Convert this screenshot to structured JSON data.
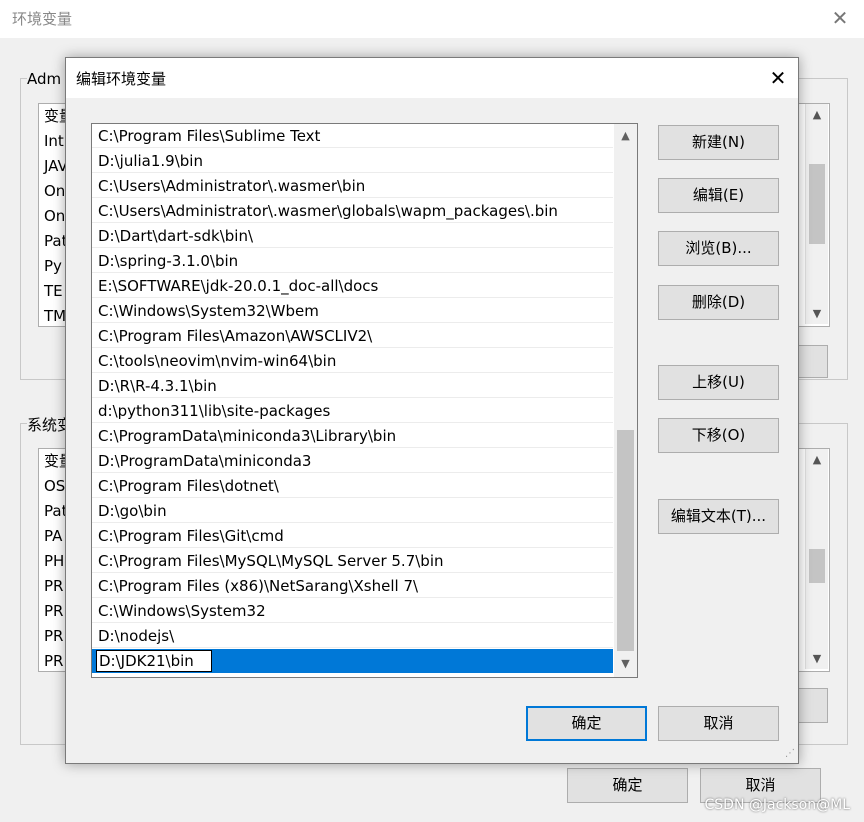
{
  "background_window": {
    "title": "环境变量",
    "user_group_label": "Adm",
    "user_vars_column": "变量",
    "user_vars": [
      "Int",
      "JAV",
      "On",
      "On",
      "Pat",
      "Py",
      "TE",
      "TM"
    ],
    "system_group_label": "系统变",
    "system_vars_column": "变量",
    "system_vars": [
      "OS",
      "Pat",
      "PA",
      "PH",
      "PR",
      "PR",
      "PR",
      "PR"
    ],
    "ok_label": "确定",
    "cancel_label": "取消"
  },
  "dialog": {
    "title": "编辑环境变量",
    "entries": [
      "C:\\Program Files\\Sublime Text",
      "D:\\julia1.9\\bin",
      "C:\\Users\\Administrator\\.wasmer\\bin",
      "C:\\Users\\Administrator\\.wasmer\\globals\\wapm_packages\\.bin",
      "D:\\Dart\\dart-sdk\\bin\\",
      "D:\\spring-3.1.0\\bin",
      "E:\\SOFTWARE\\jdk-20.0.1_doc-all\\docs",
      "C:\\Windows\\System32\\Wbem",
      "C:\\Program Files\\Amazon\\AWSCLIV2\\",
      "C:\\tools\\neovim\\nvim-win64\\bin",
      "D:\\R\\R-4.3.1\\bin",
      "d:\\python311\\lib\\site-packages",
      "C:\\ProgramData\\miniconda3\\Library\\bin",
      "D:\\ProgramData\\miniconda3",
      "C:\\Program Files\\dotnet\\",
      "D:\\go\\bin",
      "C:\\Program Files\\Git\\cmd",
      "C:\\Program Files\\MySQL\\MySQL Server 5.7\\bin",
      "C:\\Program Files (x86)\\NetSarang\\Xshell 7\\",
      "C:\\Windows\\System32",
      "D:\\nodejs\\"
    ],
    "editing_value": "D:\\JDK21\\bin",
    "buttons": {
      "new": "新建(N)",
      "edit": "编辑(E)",
      "browse": "浏览(B)...",
      "delete": "删除(D)",
      "move_up": "上移(U)",
      "move_down": "下移(O)",
      "edit_text": "编辑文本(T)..."
    },
    "ok_label": "确定",
    "cancel_label": "取消"
  },
  "watermark": "CSDN @Jackson@ML"
}
